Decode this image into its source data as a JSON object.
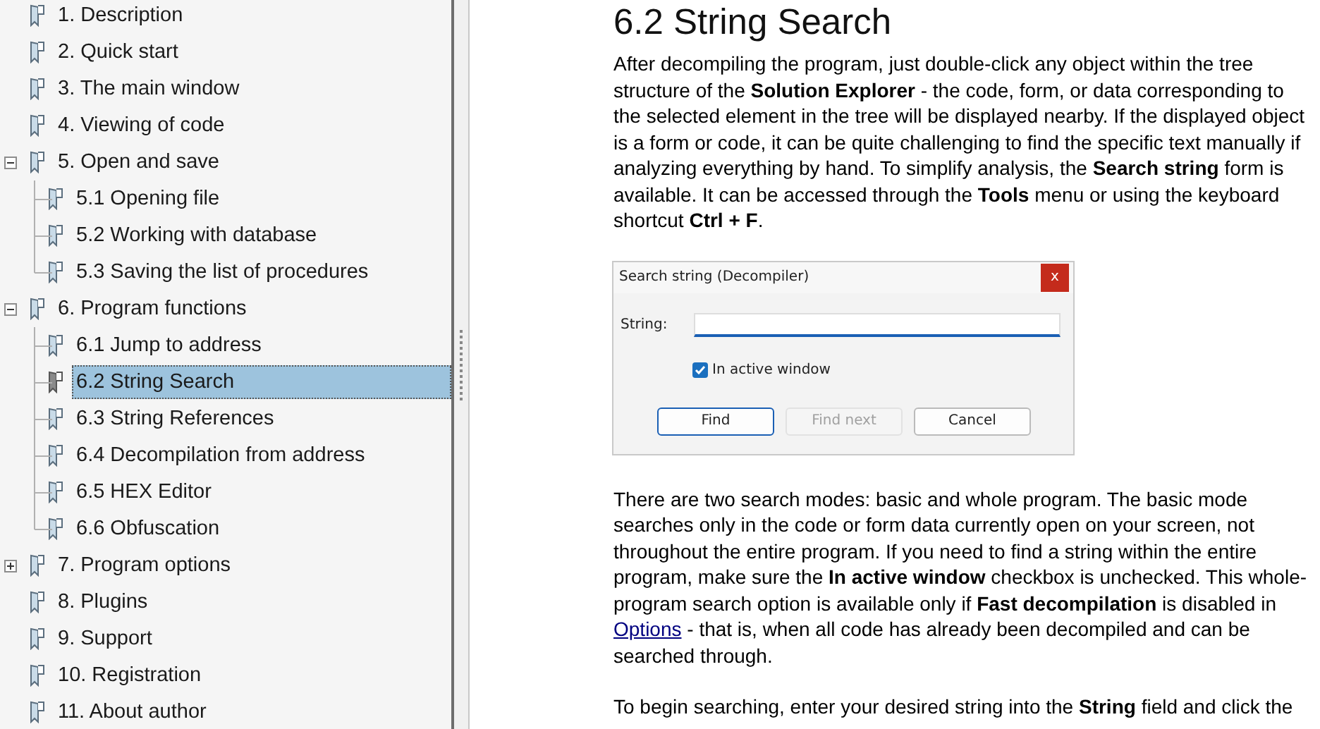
{
  "tree": {
    "items": [
      {
        "label": "1. Description",
        "selected": false
      },
      {
        "label": "2. Quick start",
        "selected": false
      },
      {
        "label": "3. The main window",
        "selected": false
      },
      {
        "label": "4. Viewing of code",
        "selected": false
      },
      {
        "label": "5. Open and save",
        "selected": false,
        "expanded": true,
        "children": [
          {
            "label": "5.1 Opening file",
            "selected": false
          },
          {
            "label": "5.2 Working with database",
            "selected": false
          },
          {
            "label": "5.3 Saving the list of procedures",
            "selected": false
          }
        ]
      },
      {
        "label": "6. Program functions",
        "selected": false,
        "expanded": true,
        "children": [
          {
            "label": "6.1 Jump to address",
            "selected": false
          },
          {
            "label": "6.2 String Search",
            "selected": true
          },
          {
            "label": "6.3 String References",
            "selected": false
          },
          {
            "label": "6.4 Decompilation from address",
            "selected": false
          },
          {
            "label": "6.5 HEX Editor",
            "selected": false
          },
          {
            "label": "6.6 Obfuscation",
            "selected": false
          }
        ]
      },
      {
        "label": "7. Program options",
        "selected": false,
        "expanded": false
      },
      {
        "label": "8. Plugins",
        "selected": false
      },
      {
        "label": "9. Support",
        "selected": false
      },
      {
        "label": "10. Registration",
        "selected": false
      },
      {
        "label": "11. About author",
        "selected": false
      }
    ]
  },
  "article": {
    "heading": "6.2 String Search",
    "blocks": [
      {
        "kind": "paragraph",
        "segments": [
          {
            "kind": "text",
            "text": "After decompiling the program, just double-click any object within the tree structure of the **Solution Explorer** - the code, form, or data corresponding to the selected element in the tree will be displayed nearby. If the displayed object is a form or code, it can be quite challenging to find the specific text manually if analyzing everything by hand. To simplify analysis, the **Search string** form is available. It can be accessed through the **Tools** menu or using the keyboard shortcut **Ctrl + F**."
          }
        ]
      },
      {
        "kind": "dialog",
        "title": "Search string (Decompiler)",
        "close": "x",
        "field_label": "String:",
        "checkbox": {
          "label": "In active window",
          "checked": true
        },
        "buttons": [
          {
            "label": "Find",
            "disabled": false,
            "focused": true
          },
          {
            "label": "Find next",
            "disabled": true,
            "focused": false
          },
          {
            "label": "Cancel",
            "disabled": false,
            "focused": false
          }
        ]
      },
      {
        "kind": "paragraph",
        "segments": [
          {
            "kind": "text",
            "text": "There are two search modes: basic and whole program. The basic mode searches only in the code or form data currently open on your screen, not throughout the entire program. If you need to find a string within the entire program, make sure the **In active window** checkbox is unchecked. This whole-program search option is available only if **Fast decompilation** is disabled in "
          },
          {
            "kind": "link",
            "text": "Options"
          },
          {
            "kind": "text",
            "text": " - that is, when all code has already been decompiled and can be searched through."
          }
        ]
      },
      {
        "kind": "paragraph",
        "segments": [
          {
            "kind": "text",
            "text": "To begin searching, enter your desired string into the **String** field and click the"
          }
        ]
      }
    ]
  }
}
